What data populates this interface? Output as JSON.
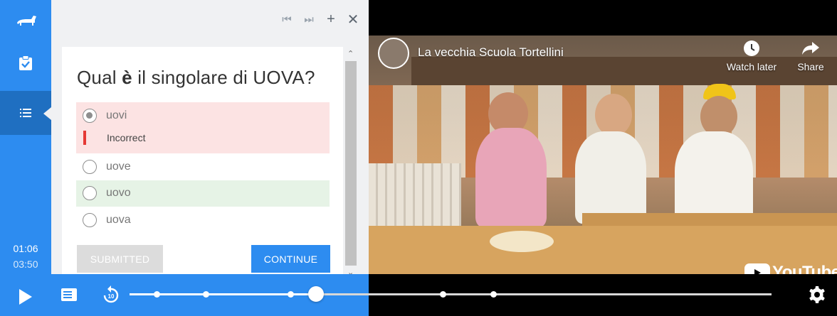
{
  "timer": {
    "current": "01:06",
    "total": "03:50"
  },
  "panel": {
    "tools": [
      "⏮",
      "⏭",
      "+",
      "✕"
    ]
  },
  "quiz": {
    "question_pre": "Qual ",
    "question_bold": "è",
    "question_post": " il singolare di UOVA?",
    "options": [
      {
        "label": "uovi",
        "state": "selected-incorrect"
      },
      {
        "label": "uove",
        "state": "unselected"
      },
      {
        "label": "uovo",
        "state": "correct"
      },
      {
        "label": "uova",
        "state": "unselected"
      }
    ],
    "feedback": "Incorrect",
    "submitted_label": "SUBMITTED",
    "continue_label": "CONTINUE"
  },
  "video": {
    "title": "La vecchia Scuola Tortellini",
    "watch_later": "Watch later",
    "share": "Share",
    "brand": "YouTube"
  },
  "progress": {
    "position_fraction": 0.29,
    "markers": [
      0.043,
      0.119,
      0.251,
      0.488,
      0.567
    ]
  },
  "colors": {
    "accent": "#2d8cf0",
    "incorrect_bg": "#fce3e3",
    "correct_bg": "#e6f3e6",
    "incorrect_mark": "#e53935"
  },
  "icons": {
    "logo": "dachshund-logo-icon",
    "quiz": "clipboard-check-icon",
    "list": "list-icon",
    "play": "play-icon",
    "notes": "notes-icon",
    "rewind": "rewind-10-icon",
    "settings": "gear-icon",
    "watch_later": "clock-icon",
    "share": "share-arrow-icon"
  }
}
